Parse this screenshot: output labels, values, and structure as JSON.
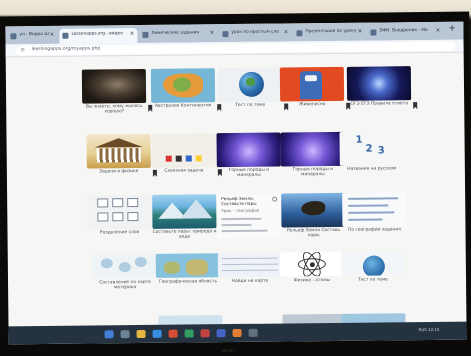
{
  "browser": {
    "tabs": [
      {
        "label": "ул - Видео Ш",
        "active": false
      },
      {
        "label": "Lessonapps.org - видео",
        "active": true
      },
      {
        "label": "Химические задания",
        "active": false
      },
      {
        "label": "урок по простым сло",
        "active": false
      },
      {
        "label": "Презентация по уроку",
        "active": false
      },
      {
        "label": "ЭФИ. Внедрение - Ми",
        "active": false
      }
    ],
    "new_tab": "+",
    "address": "learningapps.org/myapps.php"
  },
  "grid": {
    "rows": [
      [
        {
          "caption": "Вы знаете, кому жилось хорошо?",
          "thumb": "cave"
        },
        {
          "caption": "Австралия Континентия",
          "thumb": "australia"
        },
        {
          "caption": "Тест по теме",
          "thumb": "globe"
        },
        {
          "caption": "Живописно",
          "thumb": "robot"
        },
        {
          "caption": "ОГЭ ЕГЭ Правила ответа",
          "thumb": "space"
        }
      ],
      [
        {
          "caption": "Задачи в физике",
          "thumb": "temple"
        },
        {
          "caption": "Сквозная задача",
          "thumb": "swatches"
        },
        {
          "caption": "Горные породы и минералы",
          "thumb": "crystal"
        },
        {
          "caption": "Горные породы и минералы",
          "thumb": "crystal"
        },
        {
          "caption": "Названия на русском",
          "thumb": "numbers"
        }
      ],
      [
        {
          "caption": "Разделение слов",
          "thumb": "boxes"
        },
        {
          "caption": "Составьте пары: природа и вода",
          "thumb": "lake"
        },
        {
          "caption": "",
          "thumb": "text",
          "heading": "Рельеф Земли. Составьте пары",
          "subtext": "Урок - география"
        },
        {
          "caption": "Рельеф Земли Составь пары",
          "thumb": "eagle"
        },
        {
          "caption": "По географии задания",
          "thumb": "lines"
        }
      ],
      [
        {
          "caption": "Составление по карте материка",
          "thumb": "maps"
        },
        {
          "caption": "Географическая область",
          "thumb": "world"
        },
        {
          "caption": "Найди на карте",
          "thumb": "table"
        },
        {
          "caption": "Физика - атомы",
          "thumb": "atom"
        },
        {
          "caption": "Тест по теме",
          "thumb": "globe2"
        }
      ]
    ],
    "numbers_thumb": [
      "1",
      "2",
      "3"
    ]
  },
  "taskbar": {
    "tray_text": "RUS 12:15"
  },
  "monitor_brand": "acer",
  "colors": {
    "tab_strip": "#b9c6d6",
    "page_bg": "#f6f6f4",
    "taskbar": "#1d2b3a"
  }
}
